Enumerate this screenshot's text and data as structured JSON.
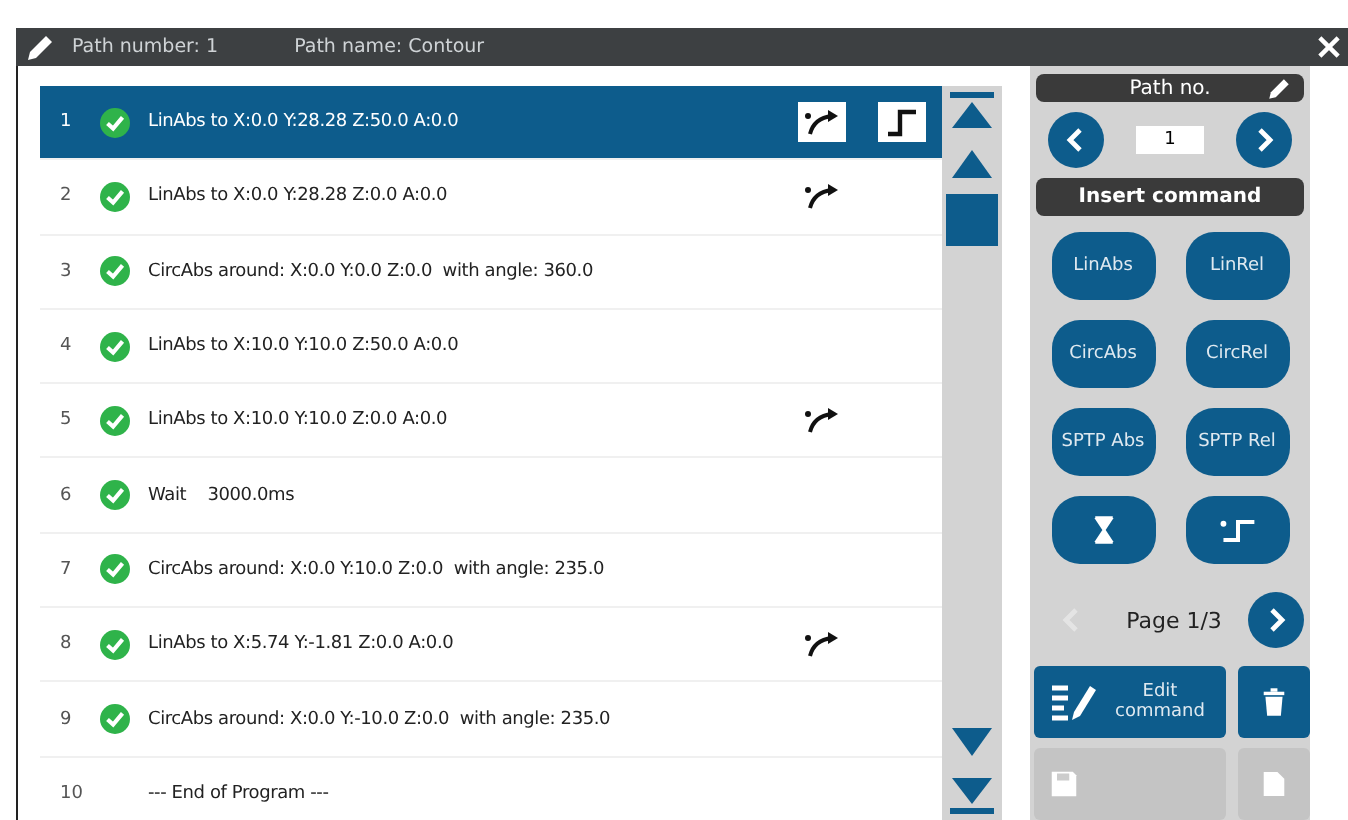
{
  "title_bar": {
    "path_number": "Path number: 1",
    "path_name": "Path name: Contour"
  },
  "commands": [
    {
      "number": "1",
      "ok": true,
      "text": "LinAbs to X:0.0 Y:28.28 Z:50.0 A:0.0",
      "blend": true,
      "step": true,
      "selected": true
    },
    {
      "number": "2",
      "ok": true,
      "text": "LinAbs to X:0.0 Y:28.28 Z:0.0 A:0.0",
      "blend": true,
      "step": false,
      "selected": false
    },
    {
      "number": "3",
      "ok": true,
      "text": "CircAbs around: X:0.0 Y:0.0 Z:0.0  with angle: 360.0",
      "blend": false,
      "step": false,
      "selected": false
    },
    {
      "number": "4",
      "ok": true,
      "text": "LinAbs to X:10.0 Y:10.0 Z:50.0 A:0.0",
      "blend": false,
      "step": false,
      "selected": false
    },
    {
      "number": "5",
      "ok": true,
      "text": "LinAbs to X:10.0 Y:10.0 Z:0.0 A:0.0",
      "blend": true,
      "step": false,
      "selected": false
    },
    {
      "number": "6",
      "ok": true,
      "text": "Wait    3000.0ms",
      "blend": false,
      "step": false,
      "selected": false
    },
    {
      "number": "7",
      "ok": true,
      "text": "CircAbs around: X:0.0 Y:10.0 Z:0.0  with angle: 235.0",
      "blend": false,
      "step": false,
      "selected": false
    },
    {
      "number": "8",
      "ok": true,
      "text": "LinAbs to X:5.74 Y:-1.81 Z:0.0 A:0.0",
      "blend": true,
      "step": false,
      "selected": false
    },
    {
      "number": "9",
      "ok": true,
      "text": "CircAbs around: X:0.0 Y:-10.0 Z:0.0  with angle: 235.0",
      "blend": false,
      "step": false,
      "selected": false
    },
    {
      "number": "10",
      "ok": false,
      "text": "--- End of Program ---",
      "blend": false,
      "step": false,
      "selected": false
    }
  ],
  "panel": {
    "path_no_label": "Path no.",
    "path_no_value": "1",
    "insert_label": "Insert command",
    "command_buttons": [
      {
        "kind": "text",
        "label": "LinAbs"
      },
      {
        "kind": "text",
        "label": "LinRel"
      },
      {
        "kind": "text",
        "label": "CircAbs"
      },
      {
        "kind": "text",
        "label": "CircRel"
      },
      {
        "kind": "text",
        "label": "SPTP Abs"
      },
      {
        "kind": "text",
        "label": "SPTP Rel"
      },
      {
        "kind": "wait"
      },
      {
        "kind": "step"
      }
    ],
    "pager": {
      "label": "Page 1/3",
      "prev_disabled": true,
      "next_disabled": false
    },
    "edit_label": "Edit command",
    "delete_disabled": false,
    "save_disabled": true,
    "new_disabled": true
  }
}
